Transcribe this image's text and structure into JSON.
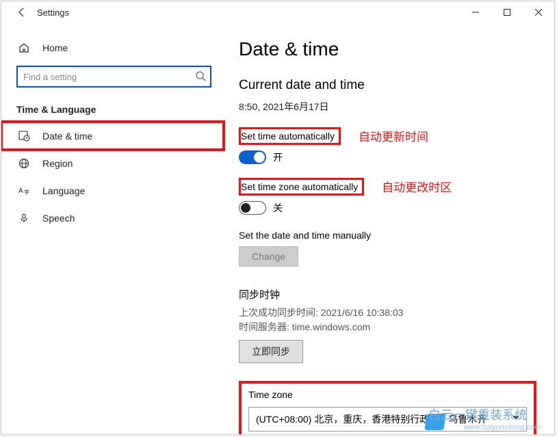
{
  "titlebar": {
    "title": "Settings"
  },
  "sidebar": {
    "home": "Home",
    "search_placeholder": "Find a setting",
    "section": "Time & Language",
    "items": [
      {
        "label": "Date & time"
      },
      {
        "label": "Region"
      },
      {
        "label": "Language"
      },
      {
        "label": "Speech"
      }
    ]
  },
  "main": {
    "h1": "Date & time",
    "h2": "Current date and time",
    "datetime": "8:50, 2021年6月17日",
    "auto_time": {
      "label": "Set time automatically",
      "anno": "自动更新时间",
      "state": "开"
    },
    "auto_tz": {
      "label": "Set time zone automatically",
      "anno": "自动更改时区",
      "state": "关"
    },
    "manual": {
      "label": "Set the date and time manually",
      "button": "Change"
    },
    "sync": {
      "heading": "同步时钟",
      "last": "上次成功同步时间: 2021/6/16 10:38:03",
      "server": "时间服务器: time.windows.com",
      "button": "立即同步"
    },
    "tz": {
      "title": "Time zone",
      "value": "(UTC+08:00) 北京，重庆，香港特别行政区，乌鲁木齐"
    }
  },
  "watermark": {
    "brand": "白云一键重装系统",
    "url": "www.baiyunxitong.com"
  }
}
